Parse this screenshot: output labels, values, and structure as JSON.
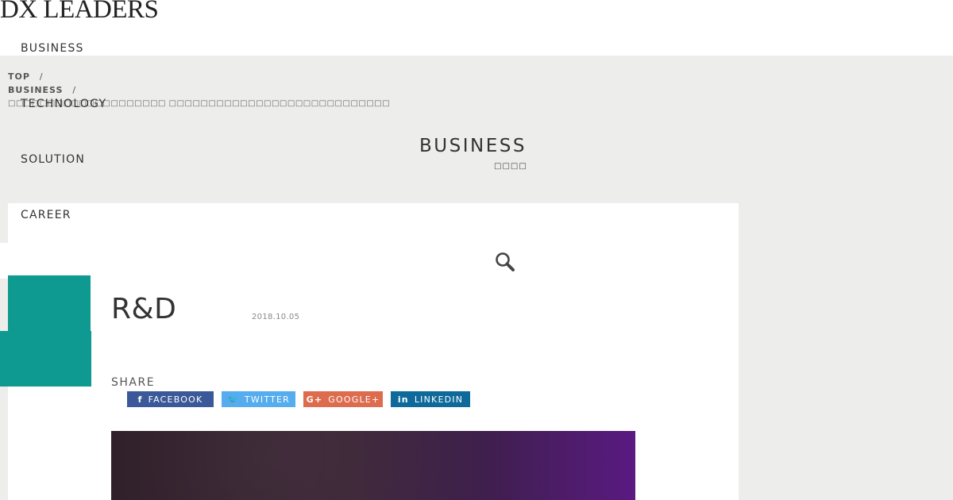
{
  "header": {
    "logo_text": "DX LEADERS"
  },
  "nav": {
    "items": [
      {
        "label": "BUSINESS"
      },
      {
        "label": "TECHNOLOGY"
      },
      {
        "label": "SOLUTION"
      },
      {
        "label": "CAREER"
      }
    ]
  },
  "breadcrumb": {
    "items": [
      {
        "label": "TOP"
      },
      {
        "label": "BUSINESS"
      }
    ],
    "separator": "/",
    "current": "□□□□□□□□□□□□□□□□□□□□ □□□□□□□□□□□□□□□□□□□□□□□□□□□□"
  },
  "category": {
    "title": "BUSINESS",
    "subtitle": "□□□□"
  },
  "search": {
    "icon": "search-icon"
  },
  "post": {
    "title": "R&D",
    "date": "2018.10.05"
  },
  "share": {
    "label": "SHARE",
    "buttons": [
      {
        "label": "FACEBOOK",
        "icon": "facebook-icon",
        "icon_glyph": "f",
        "color": "#3b5998"
      },
      {
        "label": "TWITTER",
        "icon": "twitter-icon",
        "icon_glyph": "🐦",
        "color": "#55acee"
      },
      {
        "label": "GOOGLE+",
        "icon": "google-plus-icon",
        "icon_glyph": "G+",
        "color": "#dd6b4d"
      },
      {
        "label": "LINKEDIN",
        "icon": "linkedin-icon",
        "icon_glyph": "in",
        "color": "#0e6a9a"
      }
    ]
  },
  "colors": {
    "accent": "#0e9a90",
    "background_band": "#ededeb"
  }
}
